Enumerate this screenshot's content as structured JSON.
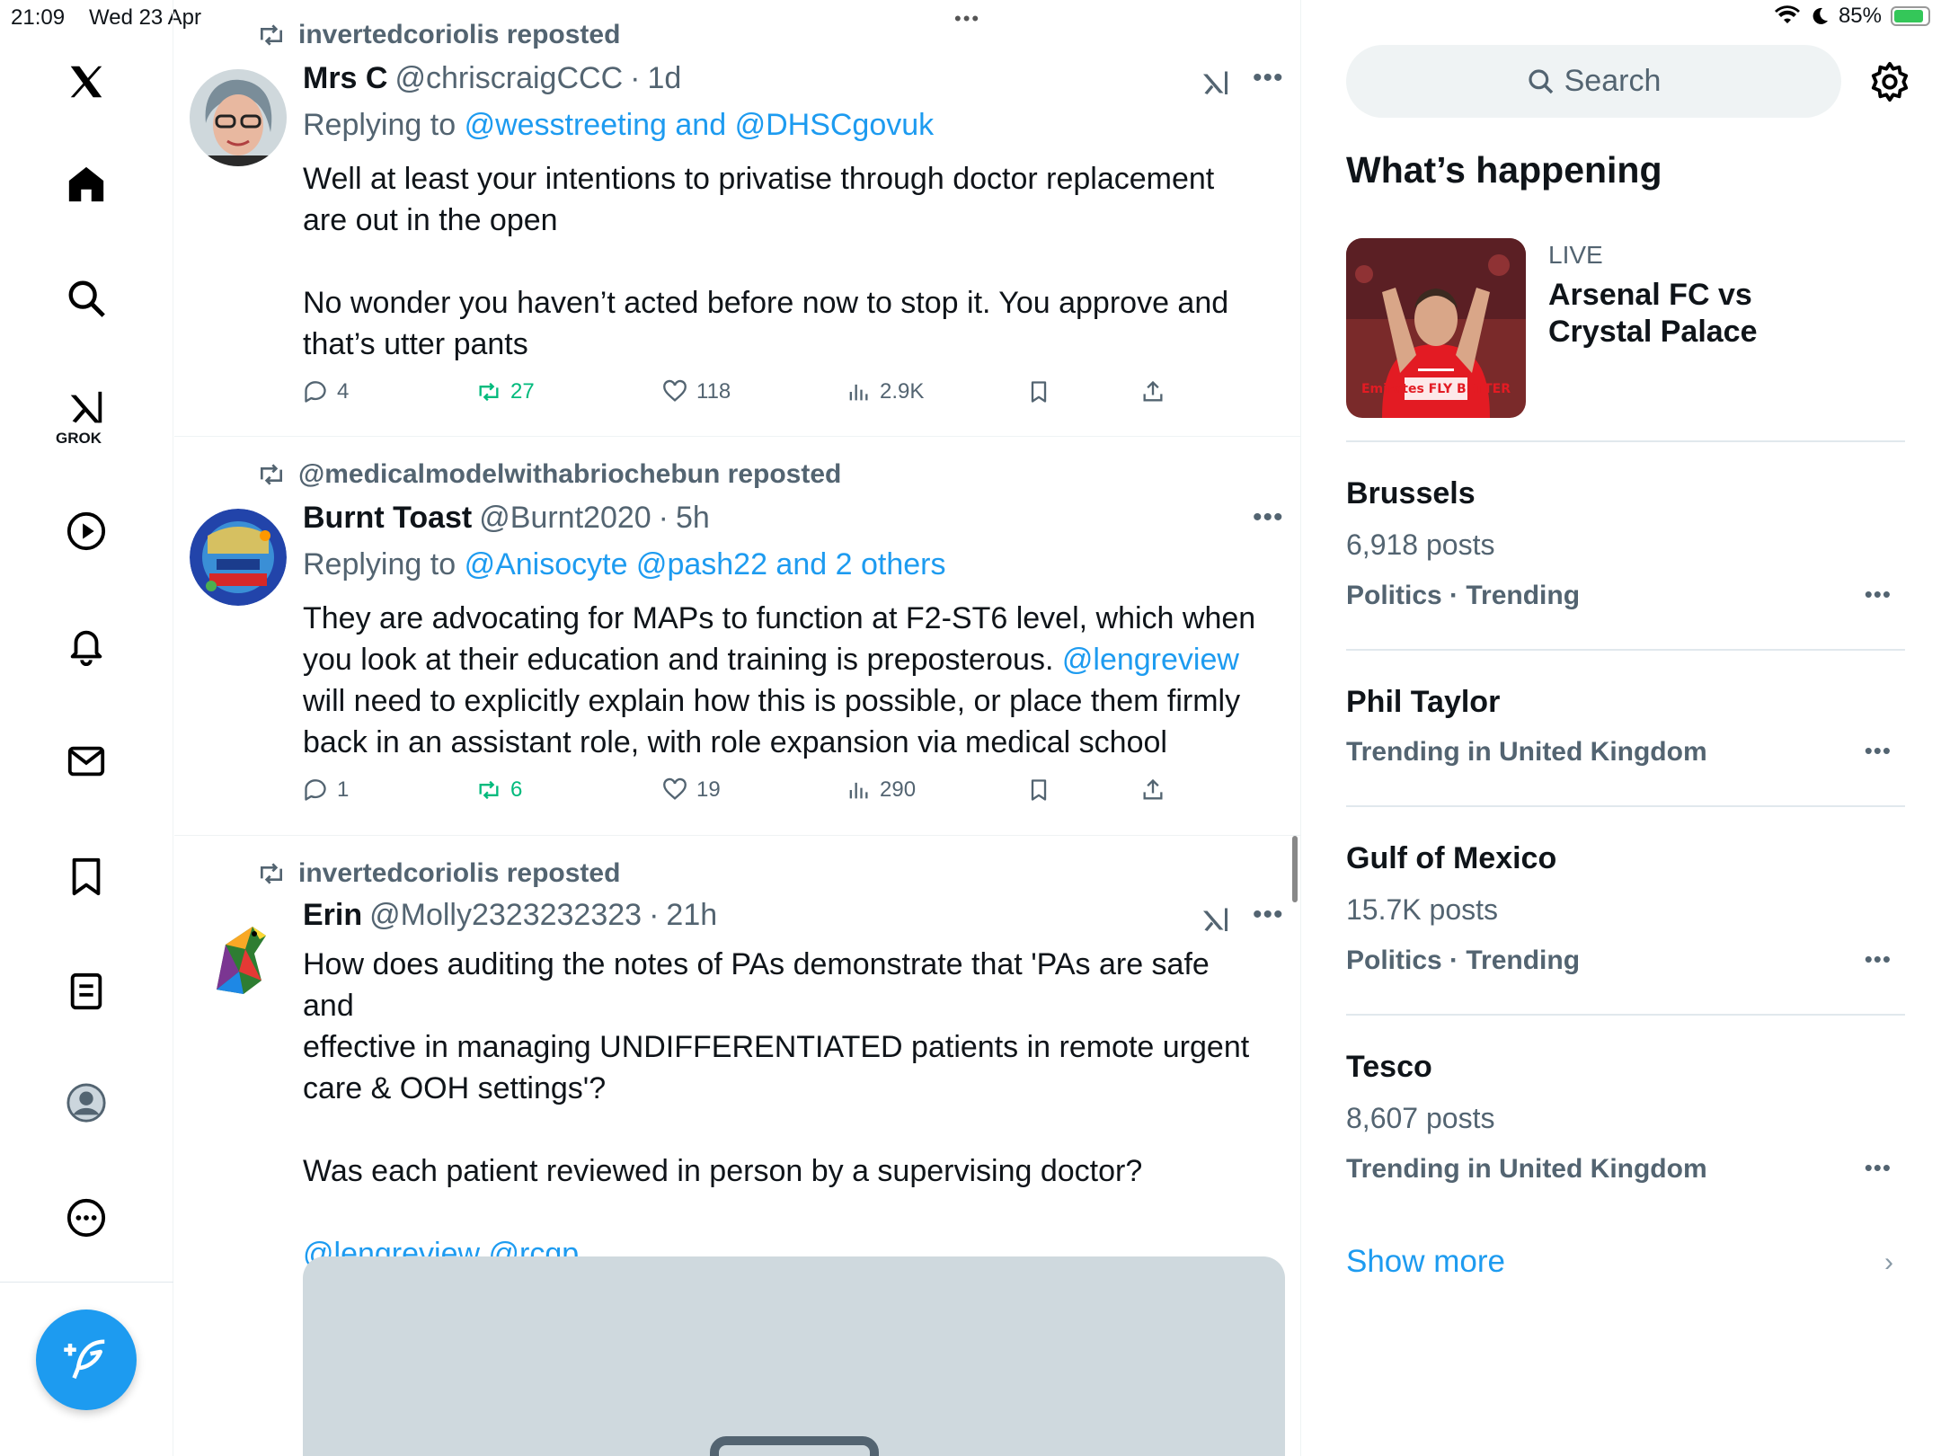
{
  "status_bar": {
    "time": "21:09",
    "date": "Wed 23 Apr",
    "battery": "85%"
  },
  "nav": {
    "grok_label": "GROK",
    "items": [
      "x-logo",
      "home",
      "explore",
      "grok",
      "video",
      "notifications",
      "messages",
      "bookmarks",
      "lists",
      "profile",
      "more"
    ]
  },
  "tweets": [
    {
      "reposted_by": "invertedcoriolis reposted",
      "name": "Mrs C",
      "handle": "@chriscraigCCC",
      "sep": "·",
      "time": "1d",
      "replying_prefix": "Replying to",
      "replying_links": "@wesstreeting and @DHSCgovuk",
      "body_lines": [
        "Well at least your intentions to privatise through doctor replacement",
        "are out in the open",
        "No wonder you haven’t acted before now to stop it. You approve and",
        "that’s utter pants"
      ],
      "replies": "4",
      "reposts": "27",
      "likes": "118",
      "views": "2.9K"
    },
    {
      "reposted_by": "@medicalmodelwithabriochebun reposted",
      "name": "Burnt Toast",
      "handle": "@Burnt2020",
      "sep": "·",
      "time": "5h",
      "replying_prefix": "Replying to",
      "replying_links": "@Anisocyte @pash22 and 2 others",
      "body_line1": "They are advocating for MAPs to function at F2-ST6 level, which when",
      "body_line2_text": "you look at their education and training is preposterous.",
      "body_line2_link": "@lengreview",
      "body_line3": "will need to explicitly explain how this is possible, or place them firmly",
      "body_line4": "back in an assistant role, with role expansion via medical school",
      "replies": "1",
      "reposts": "6",
      "likes": "19",
      "views": "290"
    },
    {
      "reposted_by": "invertedcoriolis reposted",
      "name": "Erin",
      "handle": "@Molly2323232323",
      "sep": "·",
      "time": "21h",
      "body_lines": [
        "How does auditing the notes of PAs demonstrate that 'PAs are safe and",
        "effective in managing UNDIFFERENTIATED patients in remote urgent",
        "care & OOH settings'?",
        "Was each patient reviewed in person by a supervising doctor?"
      ],
      "mentions": "@lengreview @rcgp"
    }
  ],
  "right": {
    "search_placeholder": "Search",
    "whats_happening": "What’s happening",
    "live": {
      "label": "LIVE",
      "title": "Arsenal FC vs Crystal Palace",
      "jersey_text": "Emirates FLY BETTER"
    },
    "trends": [
      {
        "title": "Brussels",
        "posts": "6,918 posts",
        "meta": "Politics · Trending"
      },
      {
        "title": "Phil Taylor",
        "posts": "",
        "meta": "Trending in United Kingdom"
      },
      {
        "title": "Gulf of Mexico",
        "posts": "15.7K posts",
        "meta": "Politics · Trending"
      },
      {
        "title": "Tesco",
        "posts": "8,607 posts",
        "meta": "Trending in United Kingdom"
      }
    ],
    "show_more": "Show more"
  },
  "colors": {
    "accent": "#1d9bf0",
    "muted": "#536471",
    "repost_green": "#00ba7c",
    "divider": "#eff3f4"
  }
}
